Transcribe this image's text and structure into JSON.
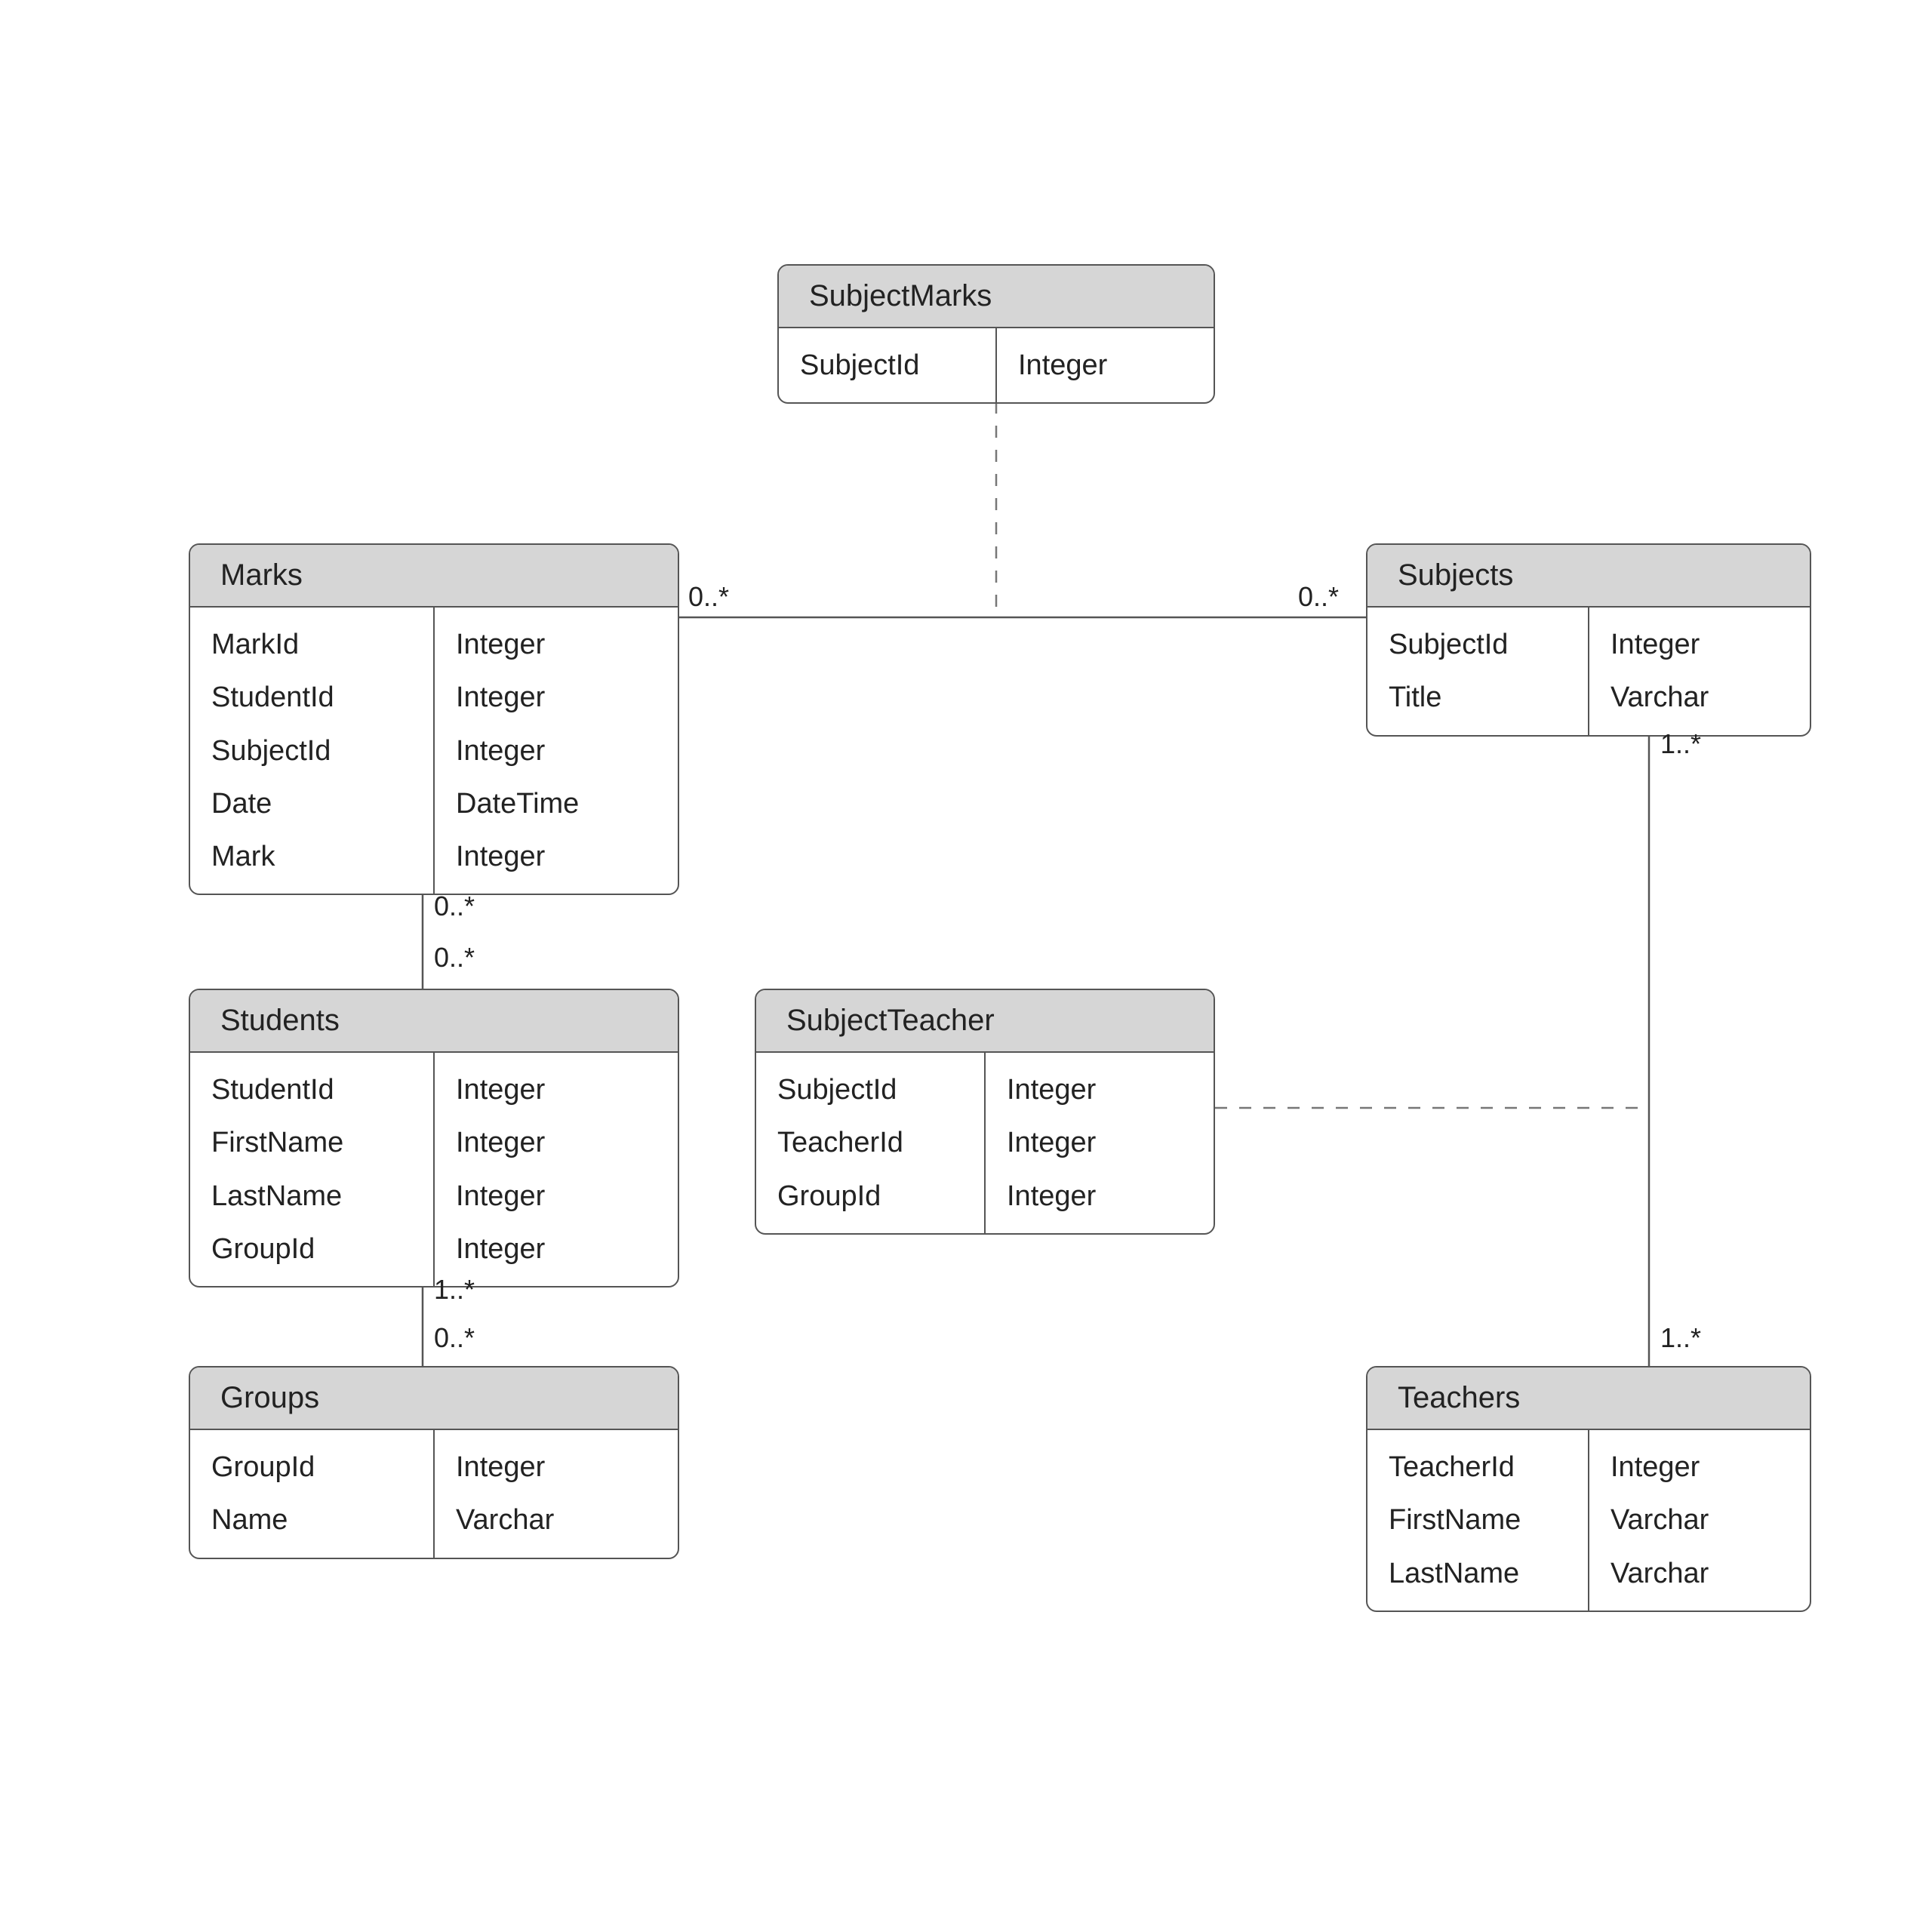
{
  "entities": {
    "subjectMarks": {
      "title": "SubjectMarks",
      "fields": [
        {
          "name": "SubjectId",
          "type": "Integer"
        }
      ]
    },
    "marks": {
      "title": "Marks",
      "fields": [
        {
          "name": "MarkId",
          "type": "Integer"
        },
        {
          "name": "StudentId",
          "type": "Integer"
        },
        {
          "name": "SubjectId",
          "type": "Integer"
        },
        {
          "name": "Date",
          "type": "DateTime"
        },
        {
          "name": "Mark",
          "type": "Integer"
        }
      ]
    },
    "subjects": {
      "title": "Subjects",
      "fields": [
        {
          "name": "SubjectId",
          "type": "Integer"
        },
        {
          "name": "Title",
          "type": "Varchar"
        }
      ]
    },
    "students": {
      "title": "Students",
      "fields": [
        {
          "name": "StudentId",
          "type": "Integer"
        },
        {
          "name": "FirstName",
          "type": "Integer"
        },
        {
          "name": "LastName",
          "type": "Integer"
        },
        {
          "name": "GroupId",
          "type": "Integer"
        }
      ]
    },
    "subjectTeacher": {
      "title": "SubjectTeacher",
      "fields": [
        {
          "name": "SubjectId",
          "type": "Integer"
        },
        {
          "name": "TeacherId",
          "type": "Integer"
        },
        {
          "name": "GroupId",
          "type": "Integer"
        }
      ]
    },
    "groups": {
      "title": "Groups",
      "fields": [
        {
          "name": "GroupId",
          "type": "Integer"
        },
        {
          "name": "Name",
          "type": "Varchar"
        }
      ]
    },
    "teachers": {
      "title": "Teachers",
      "fields": [
        {
          "name": "TeacherId",
          "type": "Integer"
        },
        {
          "name": "FirstName",
          "type": "Varchar"
        },
        {
          "name": "LastName",
          "type": "Varchar"
        }
      ]
    }
  },
  "multiplicities": {
    "marksSubjects_marksEnd": "0..*",
    "marksSubjects_subjectsEnd": "0..*",
    "marksStudents_marksEnd": "0..*",
    "marksStudents_studentsEnd": "0..*",
    "studentsGroups_studentsEnd": "1..*",
    "studentsGroups_groupsEnd": "0..*",
    "subjectsTeachers_subjectsEnd": "1..*",
    "subjectsTeachers_teachersEnd": "1..*"
  }
}
